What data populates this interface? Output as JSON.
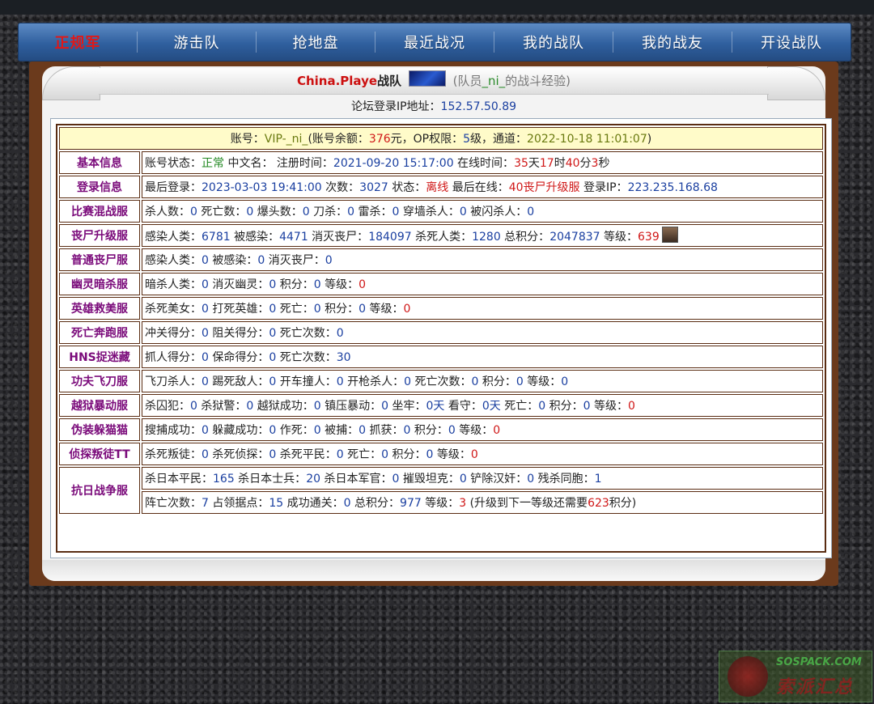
{
  "nav": {
    "items": [
      {
        "label": "正规军",
        "active": true
      },
      {
        "label": "游击队"
      },
      {
        "label": "抢地盘"
      },
      {
        "label": "最近战况"
      },
      {
        "label": "我的战队"
      },
      {
        "label": "我的战友"
      },
      {
        "label": "开设战队"
      }
    ]
  },
  "header": {
    "team_name": "China.Playe",
    "team_suffix": "战队",
    "member_text": "(队员",
    "member_name": "_ni_",
    "member_tail": "的战斗经验)",
    "ip_label": "论坛登录IP地址：",
    "ip_value": "152.57.50.89"
  },
  "account": {
    "prefix": "账号：",
    "id": "VIP-_ni_",
    "balance_label": "(账号余额：",
    "balance": "376",
    "balance_unit": "元，OP权限：",
    "op_level": "5",
    "op_unit": "级，通道：",
    "channel_date": "2022-10-18 11:01:07",
    "close": ")"
  },
  "basic": {
    "label": "基本信息",
    "status_label": "账号状态：",
    "status": "正常",
    "cn_label": " 中文名：  注册时间：",
    "reg_time": "2021-09-20 15:17:00",
    "online_label": " 在线时间：",
    "days": "35",
    "d_unit": "天",
    "hours": "17",
    "h_unit": "时",
    "mins": "40",
    "m_unit": "分",
    "secs": "3",
    "s_unit": "秒"
  },
  "login": {
    "label": "登录信息",
    "last_label": "最后登录：",
    "last_time": "2023-03-03 19:41:00",
    "count_label": " 次数：",
    "count": "3027",
    "state_label": " 状态：",
    "state": "离线",
    "last_online_label": " 最后在线：",
    "last_online": "40丧尸升级服",
    "ip_label": " 登录IP：",
    "ip": "223.235.168.68"
  },
  "rows": {
    "r1": {
      "label": "比赛混战服",
      "items": [
        [
          "杀人数：",
          "0"
        ],
        [
          " 死亡数：",
          "0"
        ],
        [
          " 爆头数：",
          "0"
        ],
        [
          " 刀杀：",
          "0"
        ],
        [
          " 雷杀：",
          "0"
        ],
        [
          " 穿墙杀人：",
          "0"
        ],
        [
          " 被闪杀人：",
          "0"
        ]
      ]
    },
    "r2": {
      "label": "丧尸升级服",
      "items": [
        [
          "感染人类：",
          "6781"
        ],
        [
          " 被感染：",
          "4471"
        ],
        [
          " 消灭丧尸：",
          "184097"
        ],
        [
          " 杀死人类：",
          "1280"
        ],
        [
          " 总积分：",
          "2047837"
        ],
        [
          " 等级：",
          "639"
        ]
      ]
    },
    "r3": {
      "label": "普通丧尸服",
      "items": [
        [
          "感染人类：",
          "0"
        ],
        [
          " 被感染：",
          "0"
        ],
        [
          " 消灭丧尸：",
          "0"
        ]
      ]
    },
    "r4": {
      "label": "幽灵暗杀服",
      "items": [
        [
          "暗杀人类：",
          "0"
        ],
        [
          " 消灭幽灵：",
          "0"
        ],
        [
          " 积分：",
          "0"
        ],
        [
          " 等级：",
          "0"
        ]
      ]
    },
    "r5": {
      "label": "英雄救美服",
      "items": [
        [
          "杀死美女：",
          "0"
        ],
        [
          " 打死英雄：",
          "0"
        ],
        [
          " 死亡：",
          "0"
        ],
        [
          " 积分：",
          "0"
        ],
        [
          " 等级：",
          "0"
        ]
      ]
    },
    "r6": {
      "label": "死亡奔跑服",
      "items": [
        [
          "冲关得分：",
          "0"
        ],
        [
          " 阻关得分：",
          "0"
        ],
        [
          " 死亡次数：",
          "0"
        ]
      ]
    },
    "r7": {
      "label": "HNS捉迷藏",
      "items": [
        [
          "抓人得分：",
          "0"
        ],
        [
          " 保命得分：",
          "0"
        ],
        [
          " 死亡次数：",
          "30"
        ]
      ]
    },
    "r8": {
      "label": "功夫飞刀服",
      "items": [
        [
          "飞刀杀人：",
          "0"
        ],
        [
          " 踢死敌人：",
          "0"
        ],
        [
          " 开车撞人：",
          "0"
        ],
        [
          " 开枪杀人：",
          "0"
        ],
        [
          " 死亡次数：",
          "0"
        ],
        [
          " 积分：",
          "0"
        ],
        [
          " 等级：",
          "0"
        ]
      ]
    },
    "r9": {
      "label": "越狱暴动服",
      "items": [
        [
          "杀囚犯：",
          "0"
        ],
        [
          " 杀狱警：",
          "0"
        ],
        [
          " 越狱成功：",
          "0"
        ],
        [
          " 镇压暴动：",
          "0"
        ],
        [
          " 坐牢：",
          "0天"
        ],
        [
          " 看守：",
          "0天"
        ],
        [
          " 死亡：",
          "0"
        ],
        [
          " 积分：",
          "0"
        ],
        [
          " 等级：",
          "0"
        ]
      ]
    },
    "r10": {
      "label": "伪装躲猫猫",
      "items": [
        [
          "搜捕成功：",
          "0"
        ],
        [
          " 躲藏成功：",
          "0"
        ],
        [
          " 作死：",
          "0"
        ],
        [
          " 被捕：",
          "0"
        ],
        [
          " 抓获：",
          "0"
        ],
        [
          " 积分：",
          "0"
        ],
        [
          " 等级：",
          "0"
        ]
      ]
    },
    "r11": {
      "label": "侦探叛徒TT",
      "items": [
        [
          "杀死叛徒：",
          "0"
        ],
        [
          " 杀死侦探：",
          "0"
        ],
        [
          " 杀死平民：",
          "0"
        ],
        [
          " 死亡：",
          "0"
        ],
        [
          " 积分：",
          "0"
        ],
        [
          " 等级：",
          "0"
        ]
      ]
    }
  },
  "kangri": {
    "label": "抗日战争服",
    "line1": [
      [
        "杀日本平民：",
        "165"
      ],
      [
        " 杀日本士兵：",
        "20"
      ],
      [
        " 杀日本军官：",
        "0"
      ],
      [
        " 摧毁坦克：",
        "0"
      ],
      [
        " 铲除汉奸：",
        "0"
      ],
      [
        " 残杀同胞：",
        "1"
      ]
    ],
    "line2": [
      [
        "阵亡次数：",
        "7"
      ],
      [
        " 占领据点：",
        "15"
      ],
      [
        " 成功通关：",
        "0"
      ],
      [
        " 总积分：",
        "977"
      ],
      [
        " 等级：",
        "3"
      ]
    ],
    "upgrade_prefix": " (升级到下一等级还需要",
    "upgrade_value": "623",
    "upgrade_suffix": "积分)"
  },
  "watermark": {
    "site": "SOSPACK.COM",
    "name": "索派汇总"
  },
  "colors": {
    "nav_bg": "#2f5f9e",
    "panel_brown": "#6b3a1c",
    "label_purple": "#7a0a7a",
    "value_blue": "#1a3fa0",
    "value_red": "#d01818",
    "account_bg": "#fffbc9"
  }
}
